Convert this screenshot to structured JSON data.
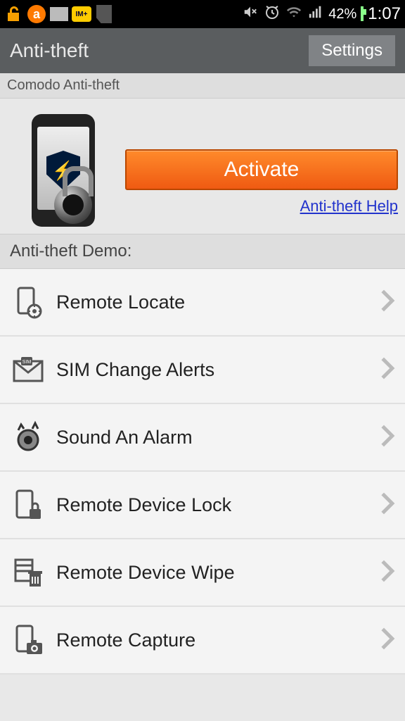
{
  "status": {
    "battery_pct": "42%",
    "time": "1:07"
  },
  "titlebar": {
    "title": "Anti-theft",
    "settings": "Settings"
  },
  "subheader": "Comodo Anti-theft",
  "hero": {
    "activate": "Activate",
    "help": "Anti-theft Help"
  },
  "demo_header": "Anti-theft Demo:",
  "rows": [
    {
      "label": "Remote Locate"
    },
    {
      "label": "SIM Change Alerts"
    },
    {
      "label": "Sound An Alarm"
    },
    {
      "label": "Remote Device Lock"
    },
    {
      "label": "Remote Device Wipe"
    },
    {
      "label": "Remote Capture"
    }
  ]
}
